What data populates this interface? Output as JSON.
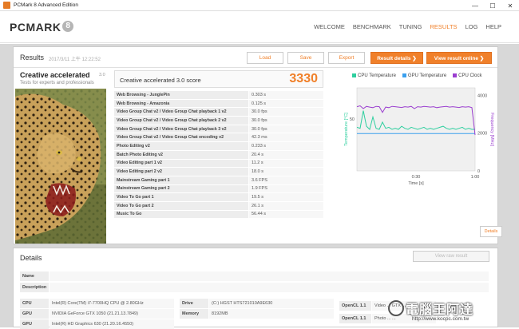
{
  "window": {
    "title": "PCMark 8 Advanced Edition",
    "minimize": "—",
    "maximize": "☐",
    "close": "✕"
  },
  "logo": {
    "text": "PCMARK",
    "badge": "8"
  },
  "nav": [
    "WELCOME",
    "BENCHMARK",
    "TUNING",
    "RESULTS",
    "LOG",
    "HELP"
  ],
  "nav_active": "RESULTS",
  "results": {
    "title": "Results",
    "date": "2017/3/11 上午 12:22:52",
    "buttons": {
      "load": "Load",
      "save": "Save",
      "export": "Export",
      "result_details": "Result details ❯",
      "view_online": "View result online ❯"
    }
  },
  "test": {
    "name": "Creative accelerated",
    "version": "3.0",
    "subtitle": "Tests for experts and professionals"
  },
  "score": {
    "label": "Creative accelerated 3.0 score",
    "value": "3330"
  },
  "rows": [
    {
      "name": "Web Browsing - JunglePin",
      "value": "0.303 s"
    },
    {
      "name": "Web Browsing - Amazonia",
      "value": "0.125 s"
    },
    {
      "name": "Video Group Chat v2 / Video Group Chat playback 1 v2",
      "value": "30.0 fps"
    },
    {
      "name": "Video Group Chat v2 / Video Group Chat playback 2 v2",
      "value": "30.0 fps"
    },
    {
      "name": "Video Group Chat v2 / Video Group Chat playback 3 v2",
      "value": "30.0 fps"
    },
    {
      "name": "Video Group Chat v2 / Video Group Chat encoding v2",
      "value": "42.3 ms"
    },
    {
      "name": "Photo Editing v2",
      "value": "0.233 s"
    },
    {
      "name": "Batch Photo Editing v2",
      "value": "20.4 s"
    },
    {
      "name": "Video Editing part 1 v2",
      "value": "11.2 s"
    },
    {
      "name": "Video Editing part 2 v2",
      "value": "18.0 s"
    },
    {
      "name": "Mainstream Gaming part 1",
      "value": "3.6 FPS"
    },
    {
      "name": "Mainstream Gaming part 2",
      "value": "1.9 FPS"
    },
    {
      "name": "Video To Go part 1",
      "value": "19.5 s"
    },
    {
      "name": "Video To Go part 2",
      "value": "26.1 s"
    },
    {
      "name": "Music To Go",
      "value": "56.44 s"
    }
  ],
  "chart_data": {
    "type": "line",
    "series": [
      {
        "name": "CPU Temperature",
        "color": "#2ecf9f",
        "axis": "left",
        "values": [
          42,
          41,
          58,
          43,
          40,
          52,
          41,
          40,
          47,
          41,
          42,
          40,
          41,
          40,
          43,
          41,
          40,
          42,
          41,
          40,
          41,
          42,
          40,
          41,
          40,
          41,
          42,
          43,
          41,
          40,
          41,
          40,
          41,
          42,
          40,
          41,
          40,
          40
        ]
      },
      {
        "name": "GPU Temperature",
        "color": "#3aa0ee",
        "axis": "left",
        "values": [
          36,
          36,
          36,
          36,
          36,
          36,
          36,
          36,
          36,
          36,
          36,
          36,
          36,
          36,
          36,
          36,
          36,
          36,
          36,
          36,
          36,
          36,
          36,
          36,
          36,
          36,
          36,
          36,
          36,
          36,
          36,
          36,
          36,
          36,
          36,
          36,
          36,
          36
        ]
      },
      {
        "name": "CPU Clock",
        "color": "#9b3fd0",
        "axis": "right",
        "values": [
          3400,
          3450,
          3300,
          3420,
          3380,
          3350,
          3420,
          3400,
          3100,
          3380,
          3350,
          3420,
          3400,
          3380,
          3360,
          3400,
          3380,
          3420,
          3300,
          3400,
          3380,
          3420,
          3400,
          3380,
          3400,
          3350,
          3380,
          3400,
          3420,
          3380,
          3400,
          3380,
          3360,
          3400,
          3380,
          3400,
          3350,
          1900
        ]
      }
    ],
    "x_ticks": [
      "0:30",
      "1:00"
    ],
    "xlabel": "Time [s]",
    "ylabel_left": "Temperature [°C]",
    "ylabel_right": "Frequency [MHz]",
    "y_left_ticks": [
      "50"
    ],
    "y_right_ticks": [
      "4000",
      "2000",
      "0"
    ],
    "y_left_range": [
      0,
      80
    ],
    "y_right_range": [
      0,
      4400
    ],
    "legend_position": "top"
  },
  "details_button": "Details",
  "details": {
    "title": "Details",
    "view_raw": "View raw result",
    "name_label": "Name",
    "desc_label": "Description",
    "cpu_label": "CPU",
    "cpu": "Intel(R) Core(TM) i7-7700HQ CPU @ 2.80GHz",
    "gpu1_label": "GPU",
    "gpu1": "NVIDIA GeForce GTX 1050 (21.21.13.7849)",
    "gpu2_label": "GPU",
    "gpu2": "Intel(R) HD Graphics 630 (21.20.16.4550)",
    "drive_label": "Drive",
    "drive": "(C:) HGST HTS721010A9E630",
    "memory_label": "Memory",
    "memory": "8192MB",
    "opencl1_label": "OpenCL 1.1",
    "opencl1": "Video ... GTX ...",
    "opencl2_label": "OpenCL 1.1",
    "opencl2": "Photo ... ..."
  },
  "watermark": {
    "text": "電腦王阿達",
    "url": "http://www.kocpc.com.tw"
  }
}
